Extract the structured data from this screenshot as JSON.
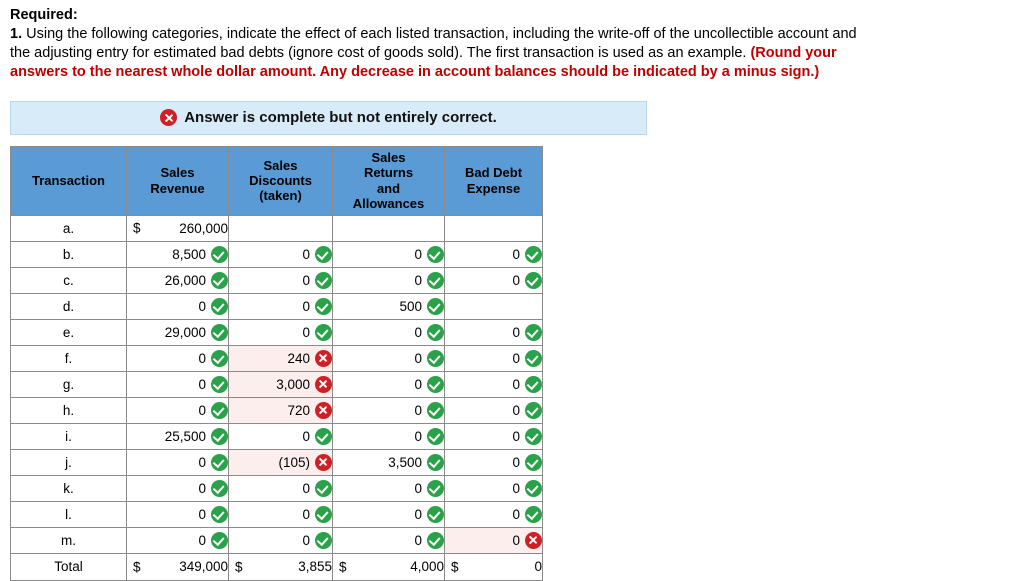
{
  "prompt": {
    "required_label": "Required:",
    "line1": "1. Using the following categories, indicate the effect of each listed transaction, including the write-off of the uncollectible account and",
    "line2_plain": "the adjusting entry for estimated bad debts (ignore cost of goods sold). The first transaction is used as an example. ",
    "line2_red": "(Round your",
    "line3_red": "answers to the nearest whole dollar amount. Any decrease in account balances should be indicated by a minus sign.)"
  },
  "banner": {
    "icon": "x-circle-icon",
    "text": "Answer is complete but not entirely correct."
  },
  "colors": {
    "header_blue": "#5b9bd5",
    "banner_blue": "#d8ebf8",
    "correct_green": "#2ba14b",
    "incorrect_red": "#cf2026",
    "wrong_cell_bg": "#fdeeee",
    "required_red": "#c00000"
  },
  "table": {
    "headers": {
      "transaction": "Transaction",
      "sales_revenue": "Sales\nRevenue",
      "sales_discounts": "Sales\nDiscounts\n(taken)",
      "sales_returns": "Sales\nReturns\nand\nAllowances",
      "bad_debt": "Bad Debt\nExpense"
    },
    "rows": [
      {
        "label": "a.",
        "revenue": {
          "dollar": "$",
          "value": "260,000",
          "mark": "none"
        },
        "discounts": {
          "dollar": "",
          "value": "",
          "mark": "none"
        },
        "returns": {
          "dollar": "",
          "value": "",
          "mark": "none"
        },
        "bad_debt": {
          "dollar": "",
          "value": "",
          "mark": "none"
        }
      },
      {
        "label": "b.",
        "revenue": {
          "dollar": "",
          "value": "8,500",
          "mark": "correct"
        },
        "discounts": {
          "dollar": "",
          "value": "0",
          "mark": "correct"
        },
        "returns": {
          "dollar": "",
          "value": "0",
          "mark": "correct"
        },
        "bad_debt": {
          "dollar": "",
          "value": "0",
          "mark": "correct"
        }
      },
      {
        "label": "c.",
        "revenue": {
          "dollar": "",
          "value": "26,000",
          "mark": "correct"
        },
        "discounts": {
          "dollar": "",
          "value": "0",
          "mark": "correct"
        },
        "returns": {
          "dollar": "",
          "value": "0",
          "mark": "correct"
        },
        "bad_debt": {
          "dollar": "",
          "value": "0",
          "mark": "correct"
        }
      },
      {
        "label": "d.",
        "revenue": {
          "dollar": "",
          "value": "0",
          "mark": "correct"
        },
        "discounts": {
          "dollar": "",
          "value": "0",
          "mark": "correct"
        },
        "returns": {
          "dollar": "",
          "value": "500",
          "mark": "correct"
        },
        "bad_debt": {
          "dollar": "",
          "value": "",
          "mark": "none"
        }
      },
      {
        "label": "e.",
        "revenue": {
          "dollar": "",
          "value": "29,000",
          "mark": "correct"
        },
        "discounts": {
          "dollar": "",
          "value": "0",
          "mark": "correct"
        },
        "returns": {
          "dollar": "",
          "value": "0",
          "mark": "correct"
        },
        "bad_debt": {
          "dollar": "",
          "value": "0",
          "mark": "correct"
        }
      },
      {
        "label": "f.",
        "revenue": {
          "dollar": "",
          "value": "0",
          "mark": "correct"
        },
        "discounts": {
          "dollar": "",
          "value": "240",
          "mark": "incorrect"
        },
        "returns": {
          "dollar": "",
          "value": "0",
          "mark": "correct"
        },
        "bad_debt": {
          "dollar": "",
          "value": "0",
          "mark": "correct"
        }
      },
      {
        "label": "g.",
        "revenue": {
          "dollar": "",
          "value": "0",
          "mark": "correct"
        },
        "discounts": {
          "dollar": "",
          "value": "3,000",
          "mark": "incorrect"
        },
        "returns": {
          "dollar": "",
          "value": "0",
          "mark": "correct"
        },
        "bad_debt": {
          "dollar": "",
          "value": "0",
          "mark": "correct"
        }
      },
      {
        "label": "h.",
        "revenue": {
          "dollar": "",
          "value": "0",
          "mark": "correct"
        },
        "discounts": {
          "dollar": "",
          "value": "720",
          "mark": "incorrect"
        },
        "returns": {
          "dollar": "",
          "value": "0",
          "mark": "correct"
        },
        "bad_debt": {
          "dollar": "",
          "value": "0",
          "mark": "correct"
        }
      },
      {
        "label": "i.",
        "revenue": {
          "dollar": "",
          "value": "25,500",
          "mark": "correct"
        },
        "discounts": {
          "dollar": "",
          "value": "0",
          "mark": "correct"
        },
        "returns": {
          "dollar": "",
          "value": "0",
          "mark": "correct"
        },
        "bad_debt": {
          "dollar": "",
          "value": "0",
          "mark": "correct"
        }
      },
      {
        "label": "j.",
        "revenue": {
          "dollar": "",
          "value": "0",
          "mark": "correct"
        },
        "discounts": {
          "dollar": "",
          "value": "(105)",
          "mark": "incorrect"
        },
        "returns": {
          "dollar": "",
          "value": "3,500",
          "mark": "correct"
        },
        "bad_debt": {
          "dollar": "",
          "value": "0",
          "mark": "correct"
        }
      },
      {
        "label": "k.",
        "revenue": {
          "dollar": "",
          "value": "0",
          "mark": "correct"
        },
        "discounts": {
          "dollar": "",
          "value": "0",
          "mark": "correct"
        },
        "returns": {
          "dollar": "",
          "value": "0",
          "mark": "correct"
        },
        "bad_debt": {
          "dollar": "",
          "value": "0",
          "mark": "correct"
        }
      },
      {
        "label": "l.",
        "revenue": {
          "dollar": "",
          "value": "0",
          "mark": "correct"
        },
        "discounts": {
          "dollar": "",
          "value": "0",
          "mark": "correct"
        },
        "returns": {
          "dollar": "",
          "value": "0",
          "mark": "correct"
        },
        "bad_debt": {
          "dollar": "",
          "value": "0",
          "mark": "correct"
        }
      },
      {
        "label": "m.",
        "revenue": {
          "dollar": "",
          "value": "0",
          "mark": "correct"
        },
        "discounts": {
          "dollar": "",
          "value": "0",
          "mark": "correct"
        },
        "returns": {
          "dollar": "",
          "value": "0",
          "mark": "correct"
        },
        "bad_debt": {
          "dollar": "",
          "value": "0",
          "mark": "incorrect"
        }
      }
    ],
    "total": {
      "label": "Total",
      "revenue": {
        "dollar": "$",
        "value": "349,000"
      },
      "discounts": {
        "dollar": "$",
        "value": "3,855"
      },
      "returns": {
        "dollar": "$",
        "value": "4,000"
      },
      "bad_debt": {
        "dollar": "$",
        "value": "0"
      }
    }
  }
}
